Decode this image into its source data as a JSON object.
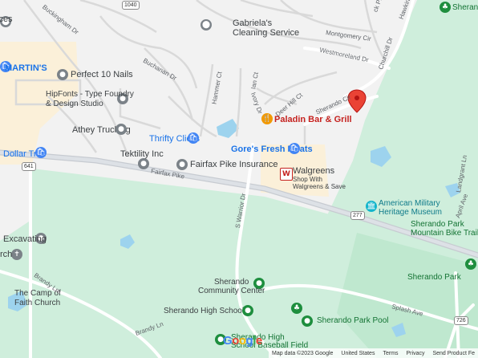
{
  "roads": {
    "buckingham_dr": "Buckingham Dr",
    "buchanan_dr": "Buchanan Dr",
    "hammer_ct": "Hammer Ct",
    "ian_ct": "Ian Ct",
    "ivory_dr": "Ivory Dr",
    "deer_hill_ct": "Deer Hill Ct",
    "sherando_cir": "Sherando Cir",
    "montgomery_cir": "Montgomery Cir",
    "westmoreland_dr": "Westmoreland Dr",
    "churchill_dr": "Churchill Dr",
    "fairfax_pike": "Fairfax Pike",
    "s_warrior_dr": "S Warrior Dr",
    "brandy_ln_1": "Brandy Ln",
    "brandy_ln_2": "Brandy Ln",
    "splash_ave": "Splash Ave",
    "landgrant_ln": "Landgrant Ln",
    "april_ave": "April Ave",
    "buckwick_pl": "ck Pl",
    "hawkins": "Hawkins"
  },
  "shields": {
    "r1040": "1040",
    "r641": "641",
    "r277": "277",
    "r726": "726"
  },
  "places": {
    "gabriela": "Gabriela's\nCleaning Service",
    "martins": "MARTIN'S",
    "perfect10": "Perfect 10 Nails",
    "hipfonts": "HipFonts - Type Foundry\n& Design Studio",
    "athey": "Athey Trucking",
    "paladin": "Paladin Bar & Grill",
    "thrifty": "Thrifty Clicks",
    "gores": "Gore's Fresh Meats",
    "tektility": "Tektility Inc",
    "fairfax_ins": "Fairfax Pike Insurance",
    "dollar_tree": "Dollar Tree",
    "walgreens": "Walgreens",
    "walgreens_sub": "Shop With\nWalgreens & Save",
    "museum": "American Military\nHeritage Museum",
    "bike_trails": "Sherando Park\nMountain Bike Trails",
    "sherando_park": "Sherando Park",
    "excavating": "Excavating",
    "church_partial": "rch",
    "faith_church": "The Camp of\nFaith Church",
    "community_center": "Sherando\nCommunity Center",
    "high_school": "Sherando High School",
    "park_pool": "Sherando Park Pool",
    "baseball": "Sherando High\nSchool Baseball Field",
    "ices": "ices",
    "sherando_top": "Sherando"
  },
  "logo": "Google",
  "attribution": [
    "Map data ©2023 Google",
    "United States",
    "Terms",
    "Privacy",
    "Send Product Fe"
  ]
}
